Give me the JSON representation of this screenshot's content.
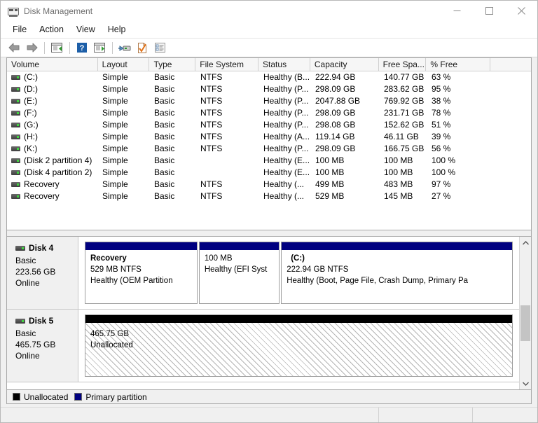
{
  "window": {
    "title": "Disk Management",
    "icon": "disk-management-icon",
    "minimize_label": "Minimize",
    "maximize_label": "Maximize",
    "close_label": "Close"
  },
  "menu": {
    "items": [
      {
        "label": "File"
      },
      {
        "label": "Action"
      },
      {
        "label": "View"
      },
      {
        "label": "Help"
      }
    ]
  },
  "toolbar": {
    "buttons": [
      {
        "name": "back-icon",
        "label": "Back"
      },
      {
        "name": "forward-icon",
        "label": "Forward"
      },
      {
        "name": "show-hide-console-tree-icon",
        "label": "Show/Hide Console Tree"
      },
      {
        "name": "help-icon",
        "label": "Help"
      },
      {
        "name": "show-hide-action-pane-icon",
        "label": "Show/Hide Action Pane"
      },
      {
        "name": "rescan-disks-icon",
        "label": "Rescan Disks"
      },
      {
        "name": "properties-icon",
        "label": "Properties"
      },
      {
        "name": "list-view-icon",
        "label": "List View"
      }
    ]
  },
  "volume_list": {
    "columns": [
      "Volume",
      "Layout",
      "Type",
      "File System",
      "Status",
      "Capacity",
      "Free Spa...",
      "% Free",
      ""
    ],
    "rows": [
      {
        "volume": "(C:)",
        "layout": "Simple",
        "type": "Basic",
        "file_system": "NTFS",
        "status": "Healthy (B...",
        "capacity": "222.94 GB",
        "free_space": "140.77 GB",
        "percent_free": "63 %"
      },
      {
        "volume": "(D:)",
        "layout": "Simple",
        "type": "Basic",
        "file_system": "NTFS",
        "status": "Healthy (P...",
        "capacity": "298.09 GB",
        "free_space": "283.62 GB",
        "percent_free": "95 %"
      },
      {
        "volume": "(E:)",
        "layout": "Simple",
        "type": "Basic",
        "file_system": "NTFS",
        "status": "Healthy (P...",
        "capacity": "2047.88 GB",
        "free_space": "769.92 GB",
        "percent_free": "38 %"
      },
      {
        "volume": "(F:)",
        "layout": "Simple",
        "type": "Basic",
        "file_system": "NTFS",
        "status": "Healthy (P...",
        "capacity": "298.09 GB",
        "free_space": "231.71 GB",
        "percent_free": "78 %"
      },
      {
        "volume": "(G:)",
        "layout": "Simple",
        "type": "Basic",
        "file_system": "NTFS",
        "status": "Healthy (P...",
        "capacity": "298.08 GB",
        "free_space": "152.62 GB",
        "percent_free": "51 %"
      },
      {
        "volume": "(H:)",
        "layout": "Simple",
        "type": "Basic",
        "file_system": "NTFS",
        "status": "Healthy (A...",
        "capacity": "119.14 GB",
        "free_space": "46.11 GB",
        "percent_free": "39 %"
      },
      {
        "volume": "(K:)",
        "layout": "Simple",
        "type": "Basic",
        "file_system": "NTFS",
        "status": "Healthy (P...",
        "capacity": "298.09 GB",
        "free_space": "166.75 GB",
        "percent_free": "56 %"
      },
      {
        "volume": "(Disk 2 partition 4)",
        "layout": "Simple",
        "type": "Basic",
        "file_system": "",
        "status": "Healthy (E...",
        "capacity": "100 MB",
        "free_space": "100 MB",
        "percent_free": "100 %"
      },
      {
        "volume": "(Disk 4 partition 2)",
        "layout": "Simple",
        "type": "Basic",
        "file_system": "",
        "status": "Healthy (E...",
        "capacity": "100 MB",
        "free_space": "100 MB",
        "percent_free": "100 %"
      },
      {
        "volume": "Recovery",
        "layout": "Simple",
        "type": "Basic",
        "file_system": "NTFS",
        "status": "Healthy (...",
        "capacity": "499 MB",
        "free_space": "483 MB",
        "percent_free": "97 %"
      },
      {
        "volume": "Recovery",
        "layout": "Simple",
        "type": "Basic",
        "file_system": "NTFS",
        "status": "Healthy (...",
        "capacity": "529 MB",
        "free_space": "145 MB",
        "percent_free": "27 %"
      }
    ]
  },
  "disks": [
    {
      "name": "Disk 4",
      "type": "Basic",
      "size": "223.56 GB",
      "state": "Online",
      "partitions": [
        {
          "label": "Recovery",
          "size_fs": "529 MB NTFS",
          "status": "Healthy (OEM Partition",
          "bar_color": "#000080",
          "width_pct": 26.5,
          "bold_label": true,
          "indent_label": false
        },
        {
          "label": "",
          "size_fs": "100 MB",
          "status": "Healthy (EFI Syst",
          "bar_color": "#000080",
          "width_pct": 19.0,
          "bold_label": false,
          "indent_label": false
        },
        {
          "label": "(C:)",
          "size_fs": "222.94 GB NTFS",
          "status": "Healthy (Boot, Page File, Crash Dump, Primary Pa",
          "bar_color": "#000080",
          "width_pct": 54.5,
          "bold_label": true,
          "indent_label": true
        }
      ]
    },
    {
      "name": "Disk 5",
      "type": "Basic",
      "size": "465.75 GB",
      "state": "Online",
      "unallocated": {
        "size": "465.75 GB",
        "label": "Unallocated",
        "bar_color": "#000000"
      }
    }
  ],
  "legend": {
    "items": [
      {
        "label": "Unallocated",
        "color": "#000000"
      },
      {
        "label": "Primary partition",
        "color": "#000080"
      }
    ]
  },
  "scrollbar": {
    "up_label": "Scroll up",
    "down_label": "Scroll down",
    "thumb_label": "Scroll thumb"
  },
  "statusbar": {
    "pane1": "",
    "pane2": "",
    "pane3": ""
  }
}
